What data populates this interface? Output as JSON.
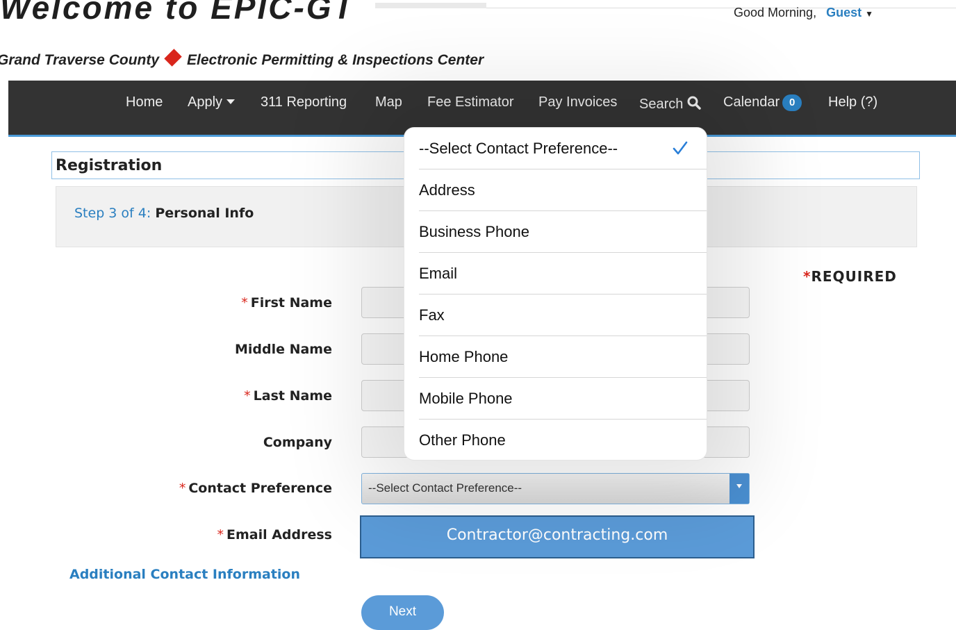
{
  "header": {
    "site_title": "Welcome to EPIC-GT",
    "greeting": "Good Morning,",
    "user": "Guest",
    "county": "Grand Traverse County",
    "center": "Electronic Permitting & Inspections Center"
  },
  "nav": {
    "items": [
      {
        "label": "Home"
      },
      {
        "label": "Apply"
      },
      {
        "label": "311 Reporting"
      },
      {
        "label": "Map"
      },
      {
        "label": "Fee Estimator"
      },
      {
        "label": "Pay Invoices"
      },
      {
        "label": "Search"
      },
      {
        "label": "Calendar"
      },
      {
        "label": "Help (?)"
      }
    ],
    "calendar_count": "0"
  },
  "registration": {
    "title": "Registration",
    "step_prefix": "Step 3 of 4:",
    "step_name": "Personal Info",
    "required_note": "REQUIRED",
    "required_star": "*"
  },
  "form": {
    "first_name_label": "First Name",
    "middle_name_label": "Middle Name",
    "last_name_label": "Last Name",
    "company_label": "Company",
    "contact_pref_label": "Contact Preference",
    "email_label": "Email Address",
    "contact_pref_value": "--Select Contact Preference--",
    "email_value": "Contractor@contracting.com",
    "additional_link": "Additional Contact Information",
    "next_label": "Next"
  },
  "dropdown": {
    "options": [
      {
        "label": "--Select Contact Preference--",
        "selected": true
      },
      {
        "label": "Address"
      },
      {
        "label": "Business Phone"
      },
      {
        "label": "Email"
      },
      {
        "label": "Fax"
      },
      {
        "label": "Home Phone"
      },
      {
        "label": "Mobile Phone"
      },
      {
        "label": "Other Phone"
      }
    ]
  },
  "colors": {
    "accent": "#2a7fc0",
    "nav_bg": "#333333",
    "required_red": "#d9261c",
    "email_box": "#5b9bd8"
  }
}
